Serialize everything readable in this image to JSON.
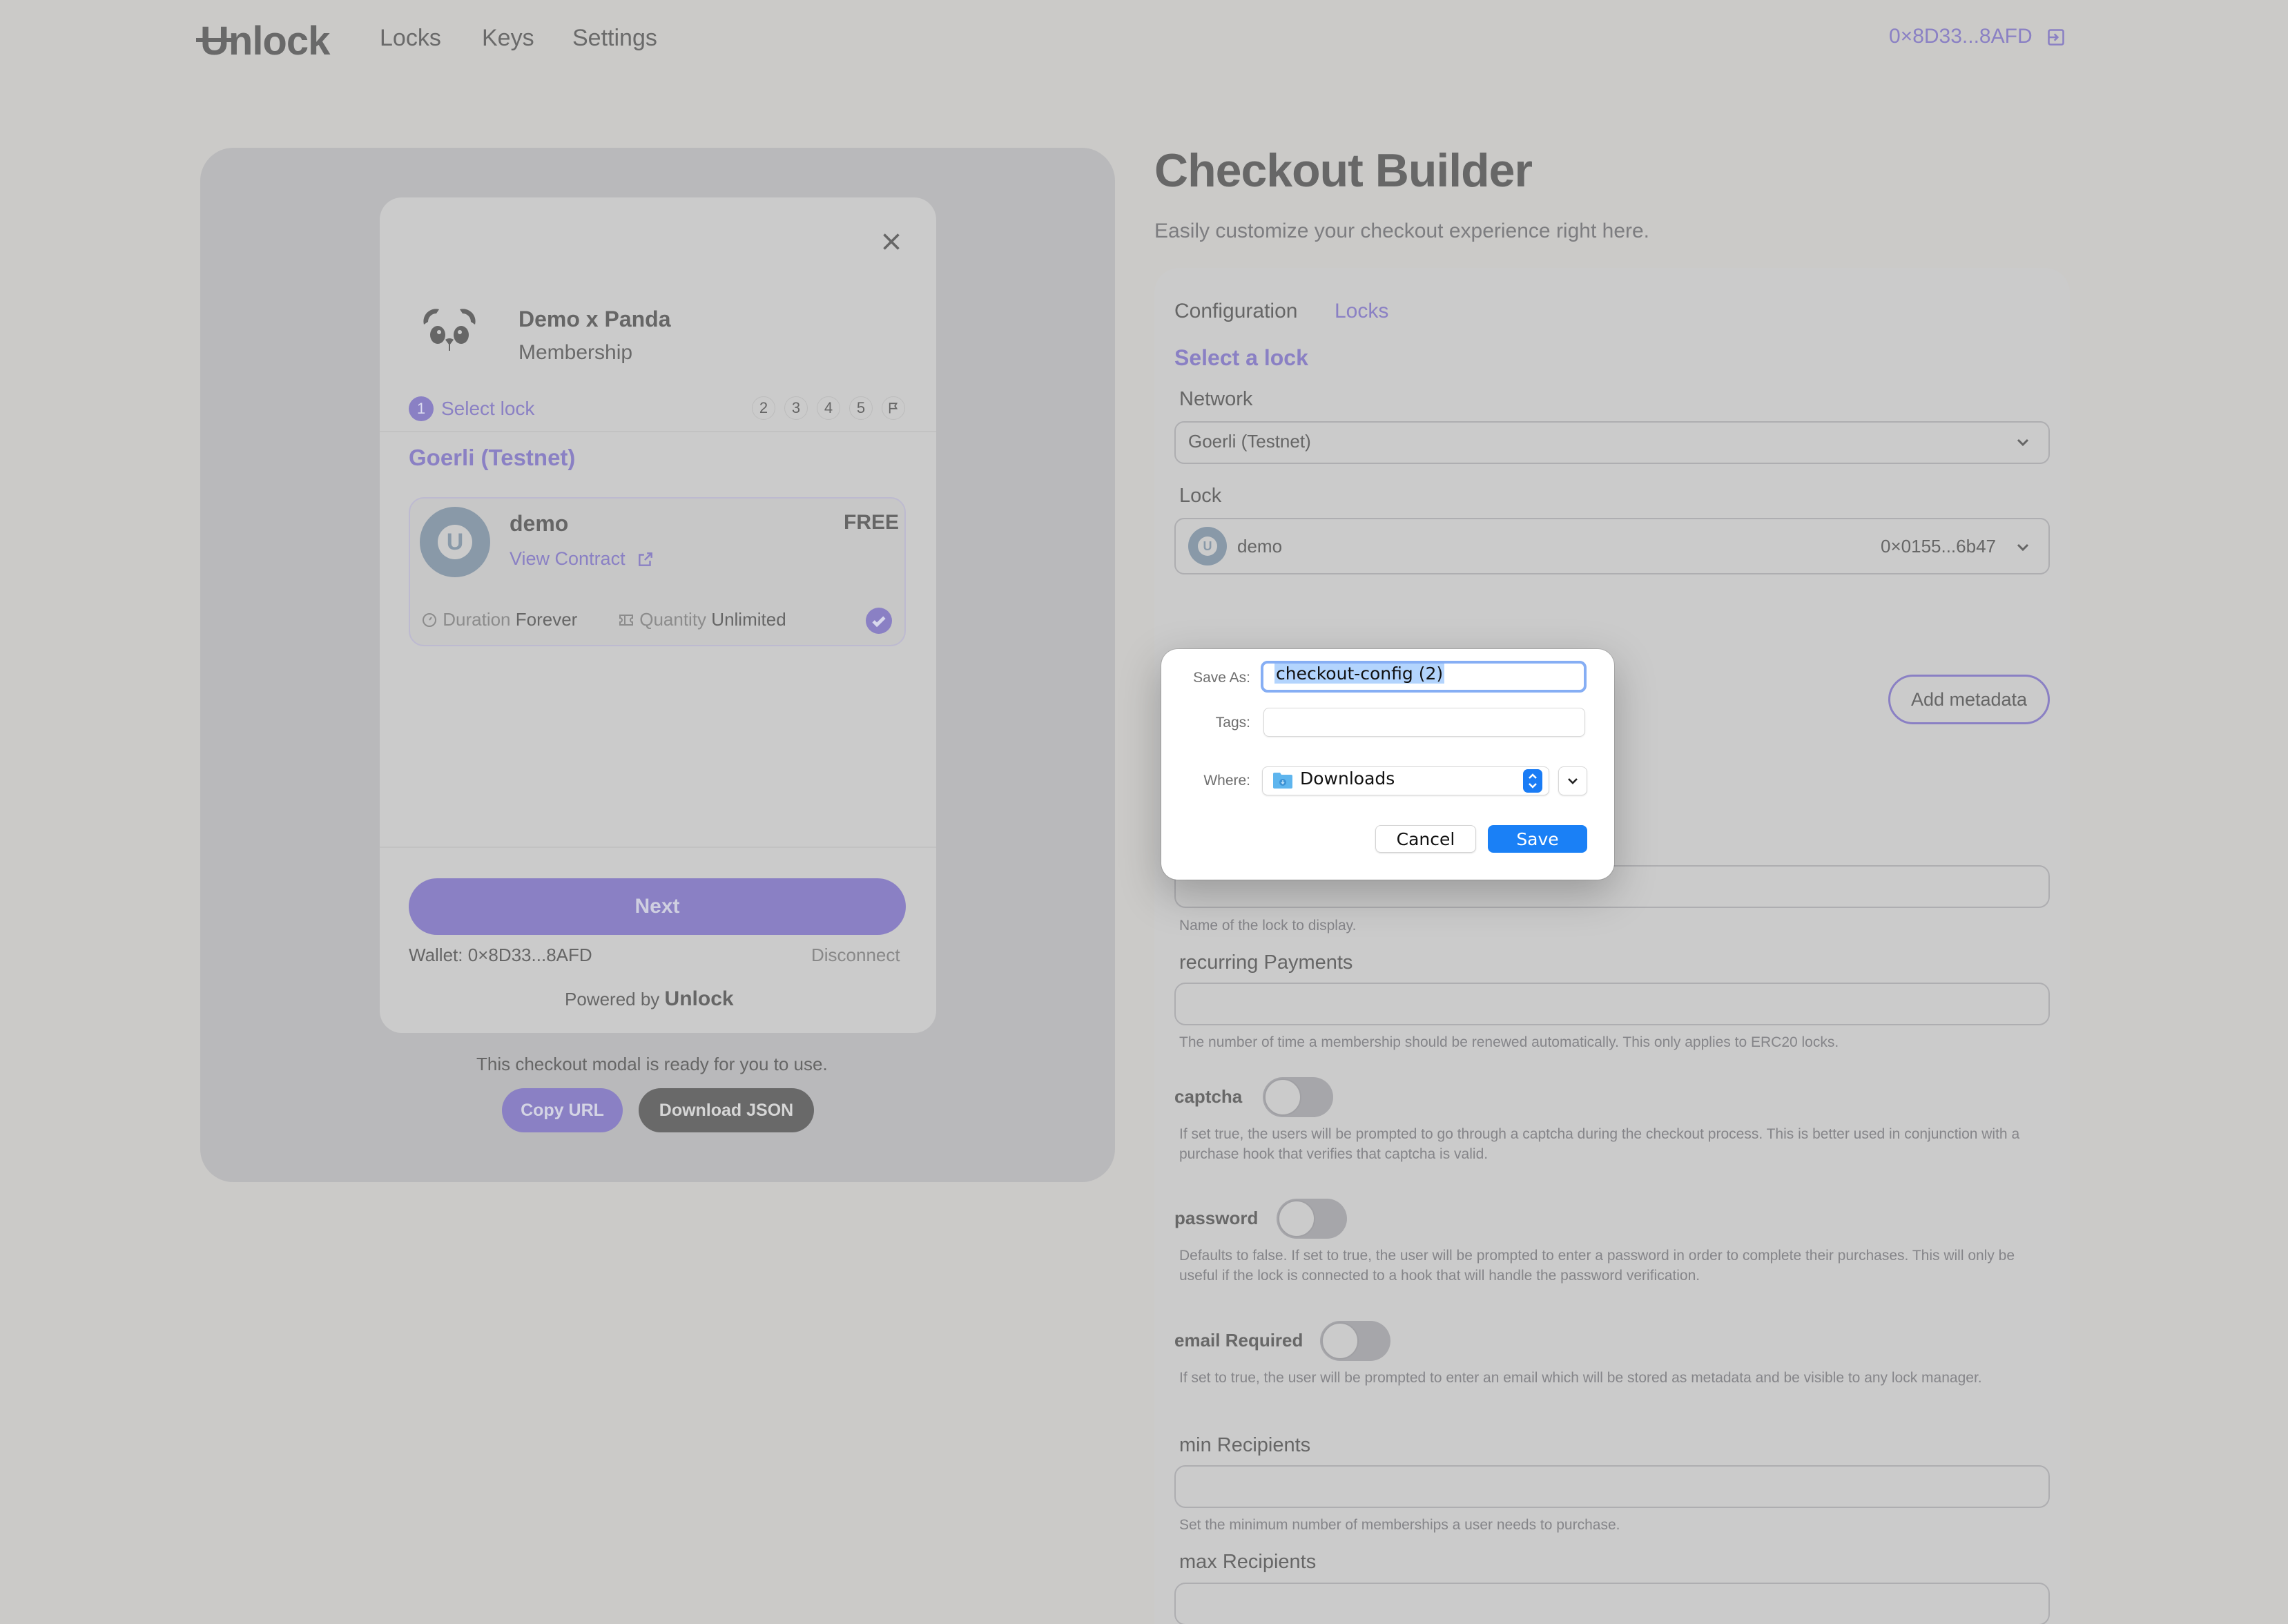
{
  "nav": {
    "logo": "Unlock",
    "links": [
      "Locks",
      "Keys",
      "Settings"
    ],
    "wallet": "0×8D33...8AFD",
    "logout_icon": "logout-icon"
  },
  "preview": {
    "modal": {
      "close_icon": "close-icon",
      "brand_title": "Demo x Panda",
      "brand_subtitle": "Membership",
      "current_step_number": "1",
      "current_step_label": "Select lock",
      "other_steps": [
        "2",
        "3",
        "4",
        "5"
      ],
      "final_step_icon": "flag-icon",
      "network": "Goerli (Testnet)",
      "lock": {
        "name": "demo",
        "price": "FREE",
        "view_contract": "View Contract",
        "duration_label": "Duration",
        "duration_value": "Forever",
        "quantity_label": "Quantity",
        "quantity_value": "Unlimited",
        "selected": true
      },
      "next_button": "Next",
      "wallet": "Wallet: 0×8D33...8AFD",
      "disconnect": "Disconnect",
      "powered_by": "Powered by",
      "powered_brand": "Unlock"
    },
    "ready_text": "This checkout modal is ready for you to use.",
    "copy_url": "Copy URL",
    "download_json": "Download JSON"
  },
  "builder": {
    "title": "Checkout Builder",
    "subtitle": "Easily customize your checkout experience right here.",
    "tabs": [
      {
        "label": "Configuration",
        "active": false
      },
      {
        "label": "Locks",
        "active": true
      }
    ],
    "section_title": "Select a lock",
    "network_label": "Network",
    "network_value": "Goerli (Testnet)",
    "lock_label": "Lock",
    "lock_value": "demo",
    "lock_address": "0×0155...6b47",
    "add_metadata": "Add metadata",
    "name_help": "Name of the lock to display.",
    "recurring_label": "recurring Payments",
    "recurring_help": "The number of time a membership should be renewed automatically. This only applies to ERC20 locks.",
    "captcha_label": "captcha",
    "captcha_on": false,
    "captcha_help": "If set true, the users will be prompted to go through a captcha during the checkout process. This is better used in conjunction with a purchase hook that verifies that captcha is valid.",
    "password_label": "password",
    "password_on": false,
    "password_help": "Defaults to false. If set to true, the user will be prompted to enter a password in order to complete their purchases. This will only be useful if the lock is connected to a hook that will handle the password verification.",
    "email_label": "email Required",
    "email_on": false,
    "email_help": "If set to true, the user will be prompted to enter an email which will be stored as metadata and be visible to any lock manager.",
    "min_label": "min Recipients",
    "min_help": "Set the minimum number of memberships a user needs to purchase.",
    "max_label": "max Recipients"
  },
  "save_dialog": {
    "save_as_label": "Save As:",
    "save_as_value": "checkout-config (2)",
    "tags_label": "Tags:",
    "tags_value": "",
    "where_label": "Where:",
    "where_value": "Downloads",
    "cancel": "Cancel",
    "save": "Save"
  },
  "colors": {
    "accent": "#8a80c4",
    "mac_blue": "#1a80f6",
    "background": "#cbcac8"
  }
}
